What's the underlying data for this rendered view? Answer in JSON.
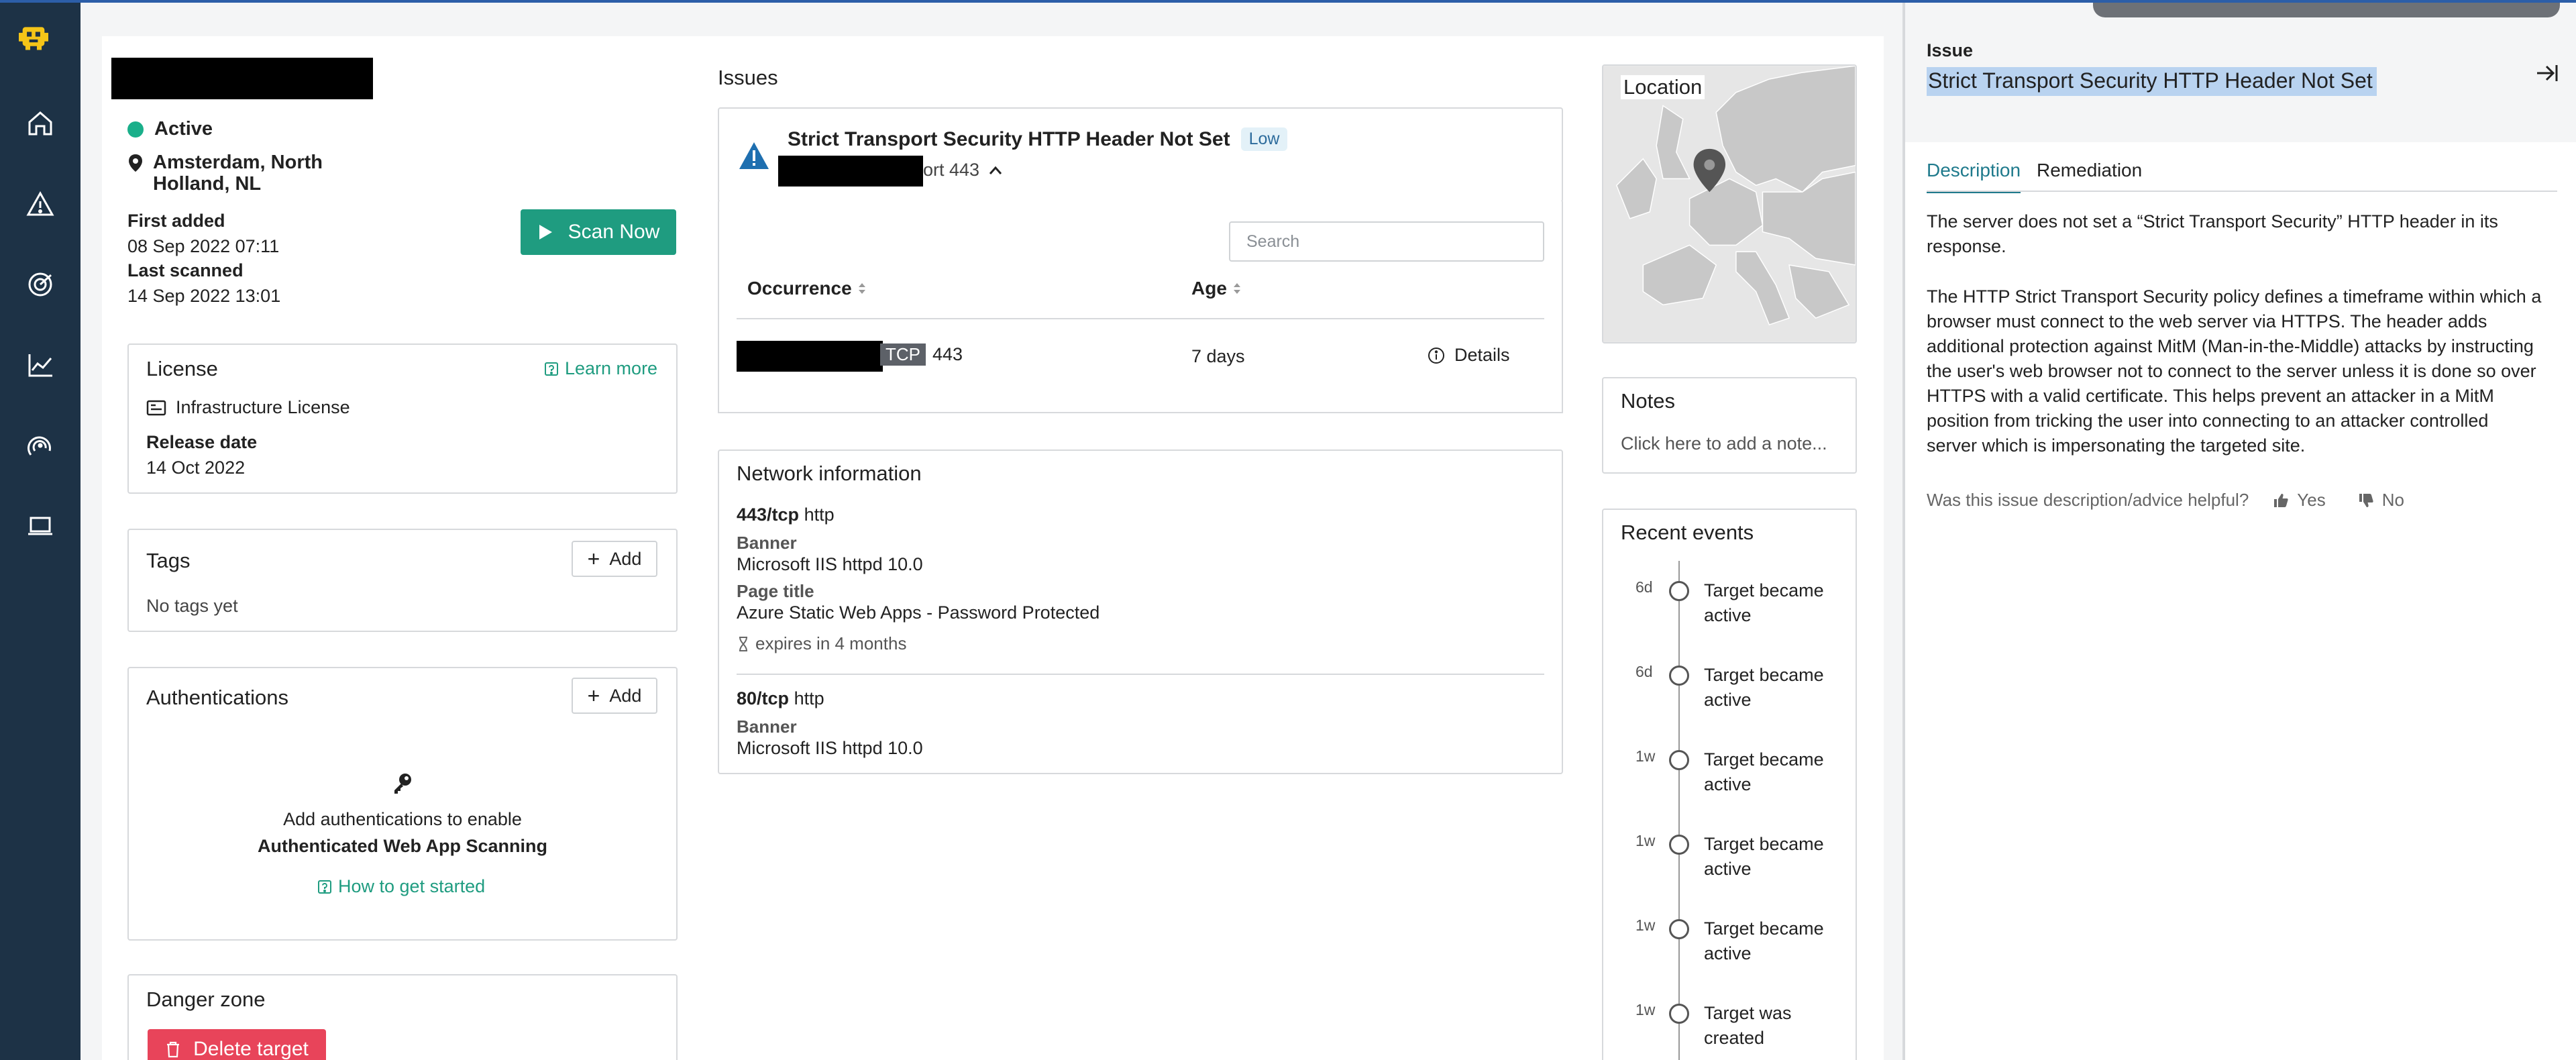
{
  "target": {
    "status": "Active",
    "location": "Amsterdam, North Holland, NL",
    "first_added_label": "First added",
    "first_added": "08 Sep 2022 07:11",
    "last_scanned_label": "Last scanned",
    "last_scanned": "14 Sep 2022 13:01",
    "scan_button": "Scan Now"
  },
  "license": {
    "title": "License",
    "learn_more": "Learn more",
    "name": "Infrastructure License",
    "release_label": "Release date",
    "release_date": "14 Oct 2022"
  },
  "tags": {
    "title": "Tags",
    "add": "Add",
    "empty": "No tags yet"
  },
  "auth": {
    "title": "Authentications",
    "add": "Add",
    "empty_line1": "Add authentications to enable",
    "empty_line2": "Authenticated Web App Scanning",
    "how_to": "How to get started"
  },
  "danger": {
    "title": "Danger zone",
    "delete": "Delete target"
  },
  "issues": {
    "title": "Issues",
    "issue_title": "Strict Transport Security HTTP Header Not Set",
    "severity": "Low",
    "port_suffix": "ort 443",
    "search_placeholder": "Search",
    "col_occurrence": "Occurrence",
    "col_age": "Age",
    "row": {
      "protocol": "TCP",
      "port": "443",
      "age": "7 days",
      "details": "Details"
    }
  },
  "network": {
    "title": "Network information",
    "entries": [
      {
        "port": "443/tcp",
        "service": "http",
        "banner_label": "Banner",
        "banner": "Microsoft IIS httpd 10.0",
        "page_title_label": "Page title",
        "page_title": "Azure Static Web Apps - Password Protected",
        "expires": "expires in 4 months"
      },
      {
        "port": "80/tcp",
        "service": "http",
        "banner_label": "Banner",
        "banner": "Microsoft IIS httpd 10.0"
      }
    ]
  },
  "location_panel": {
    "title": "Location"
  },
  "notes": {
    "title": "Notes",
    "placeholder": "Click here to add a note..."
  },
  "events": {
    "title": "Recent events",
    "items": [
      {
        "age": "6d",
        "line1": "Target became",
        "line2": "active"
      },
      {
        "age": "6d",
        "line1": "Target became",
        "line2": "active"
      },
      {
        "age": "1w",
        "line1": "Target became",
        "line2": "active"
      },
      {
        "age": "1w",
        "line1": "Target became",
        "line2": "active"
      },
      {
        "age": "1w",
        "line1": "Target became",
        "line2": "active"
      },
      {
        "age": "1w",
        "line1": "Target was",
        "line2": "created"
      }
    ]
  },
  "drawer": {
    "label": "Issue",
    "title": "Strict Transport Security HTTP Header Not Set",
    "tab_description": "Description",
    "tab_remediation": "Remediation",
    "para1_line1": "The server does not set a “Strict Transport Security” HTTP header in its",
    "para1_line2": "response.",
    "para2_lines": [
      "The HTTP Strict Transport Security policy defines a timeframe within which a",
      "browser must connect to the web server via HTTPS. The header adds",
      "additional protection against MitM (Man-in-the-Middle) attacks by instructing",
      "the user's web browser not to connect to the server unless it is done so over",
      "HTTPS with a valid certificate. This helps prevent an attacker in a MitM",
      "position from tricking the user into connecting to an attacker controlled",
      "server which is impersonating the targeted site."
    ],
    "helpful_question": "Was this issue description/advice helpful?",
    "yes": "Yes",
    "no": "No"
  },
  "colors": {
    "accent": "#1f9c80",
    "nav": "#1d3246",
    "danger": "#e8445a",
    "logo": "#f5c518"
  }
}
